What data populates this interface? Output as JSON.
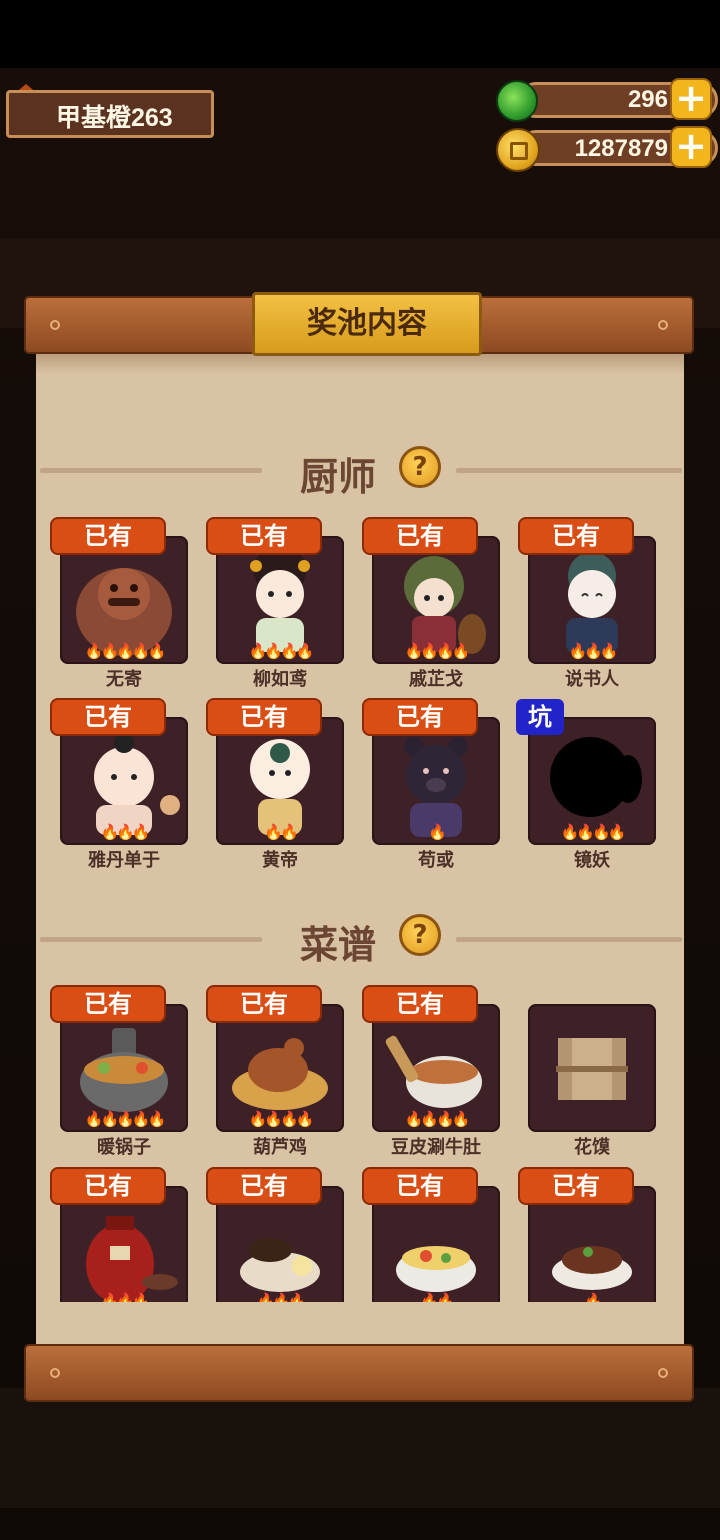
{
  "player": {
    "name": "甲基橙263"
  },
  "resources": {
    "gems": "296",
    "coins": "1287879"
  },
  "panel": {
    "title": "奖池内容"
  },
  "colors": {
    "owned_badge": "#d94e14",
    "special_badge": "#2223c8",
    "card_bg": "#3d2126",
    "paper": "#d9c3a5"
  },
  "chefs": {
    "title": "厨师",
    "items": [
      {
        "name": "无寄",
        "badge": "已有",
        "flames": "🔥🔥🔥🔥🔥"
      },
      {
        "name": "柳如鸢",
        "badge": "已有",
        "flames": "🔥🔥🔥🔥"
      },
      {
        "name": "戚芷戈",
        "badge": "已有",
        "flames": "🔥🔥🔥🔥"
      },
      {
        "name": "说书人",
        "badge": "已有",
        "flames": "🔥🔥🔥"
      },
      {
        "name": "雅丹单于",
        "badge": "已有",
        "flames": "🔥🔥🔥"
      },
      {
        "name": "黄帝",
        "badge": "已有",
        "flames": "🔥🔥"
      },
      {
        "name": "苟或",
        "badge": "已有",
        "flames": "🔥"
      },
      {
        "name": "镜妖",
        "badge": "坑",
        "flames": "🔥🔥🔥🔥"
      }
    ]
  },
  "recipes": {
    "title": "菜谱",
    "items": [
      {
        "name": "暖锅子",
        "badge": "已有",
        "flames": "🔥🔥🔥🔥🔥"
      },
      {
        "name": "葫芦鸡",
        "badge": "已有",
        "flames": "🔥🔥🔥🔥"
      },
      {
        "name": "豆皮涮牛肚",
        "badge": "已有",
        "flames": "🔥🔥🔥🔥"
      },
      {
        "name": "花馍",
        "badge": "",
        "flames": ""
      },
      {
        "name": "",
        "badge": "已有",
        "flames": "🔥🔥🔥"
      },
      {
        "name": "",
        "badge": "已有",
        "flames": "🔥🔥🔥"
      },
      {
        "name": "",
        "badge": "已有",
        "flames": "🔥🔥"
      },
      {
        "name": "",
        "badge": "已有",
        "flames": "🔥"
      }
    ]
  }
}
